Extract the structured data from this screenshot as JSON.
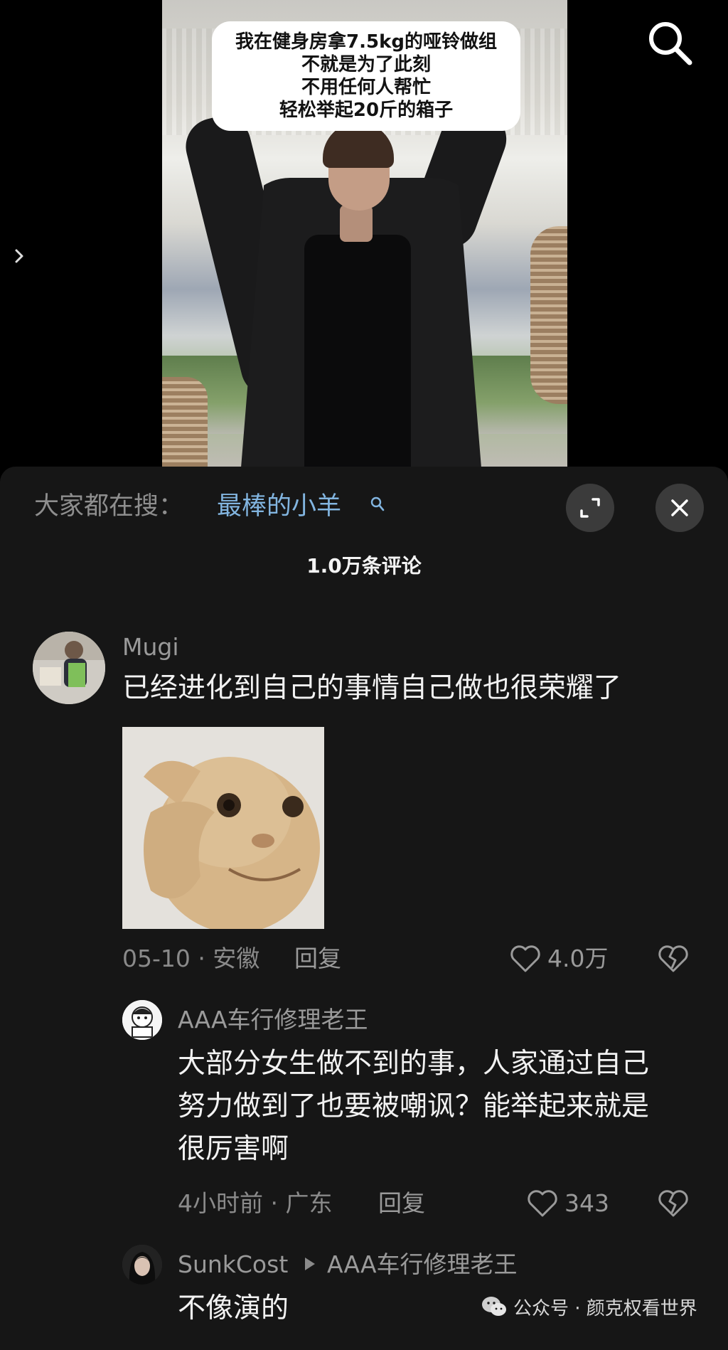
{
  "video": {
    "caption_lines": [
      "我在健身房拿7.5kg的哑铃做组",
      "不就是为了此刻",
      "不用任何人帮忙",
      "轻松举起20斤的箱子"
    ],
    "search_icon": "search-icon",
    "prev_icon": "chevron-right-icon"
  },
  "panel": {
    "trending_label": "大家都在搜：",
    "trending_query": "最棒的小羊",
    "comment_count": "1.0万条评论",
    "expand_icon": "expand-icon",
    "close_icon": "close-icon"
  },
  "comments": [
    {
      "username": "Mugi",
      "text": "已经进化到自己的事情自己做也很荣耀了",
      "has_sticker": true,
      "date": "05-10 · 安徽",
      "reply_label": "回复",
      "likes": "4.0万"
    },
    {
      "username": "AAA车行修理老王",
      "text_lines": [
        "大部分女生做不到的事，人家通过自己",
        "努力做到了也要被嘲讽？能举起来就是",
        "很厉害啊"
      ],
      "date": "4小时前 · 广东",
      "reply_label": "回复",
      "likes": "343"
    },
    {
      "username": "SunkCost",
      "reply_to": "AAA车行修理老王",
      "text": "不像演的"
    }
  ],
  "watermark": {
    "text": "公众号 · 颜克权看世界",
    "icon": "wechat-icon"
  },
  "colors": {
    "panel_bg": "#161616",
    "link_blue": "#82b5e0",
    "muted_text": "#9a9a9a",
    "primary_text": "#f2f2f2"
  }
}
